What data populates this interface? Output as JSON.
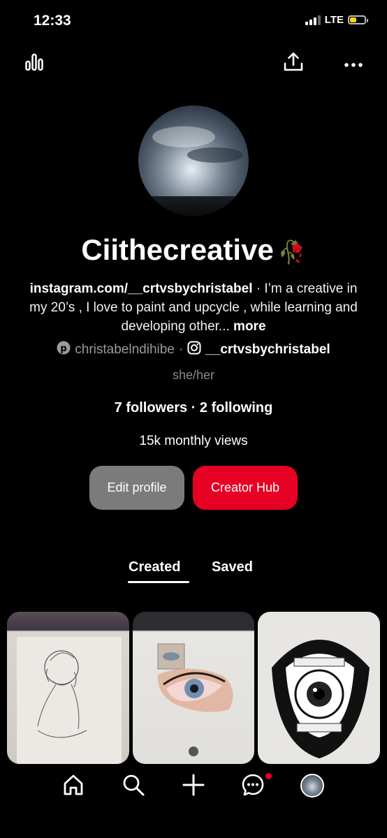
{
  "status_bar": {
    "time": "12:33",
    "network": "LTE"
  },
  "profile": {
    "name": "Ciithecreative",
    "bio_link": "instagram.com/__crtvsbychristabel",
    "bio_text": " · I’m a creative in my 20’s , I love to paint and upcycle , while learning and developing other... ",
    "bio_more": "more",
    "pinterest_handle": "christabelndihibe",
    "separator": "·",
    "instagram_handle": "__crtvsbychristabel",
    "pronouns": "she/her",
    "followers_following": "7 followers · 2 following",
    "monthly_views": "15k monthly views"
  },
  "actions": {
    "edit_profile": "Edit profile",
    "creator_hub": "Creator Hub"
  },
  "tabs": [
    {
      "label": "Created",
      "active": true
    },
    {
      "label": "Saved",
      "active": false
    }
  ],
  "pins": [
    {
      "subject": "pencil sketch of a person holding their face"
    },
    {
      "subject": "realistic painting of an eye on tablet"
    },
    {
      "subject": "ink illustration of an eye inside a mouth"
    }
  ],
  "bottom_nav": [
    {
      "icon": "home-icon"
    },
    {
      "icon": "search-icon"
    },
    {
      "icon": "plus-icon"
    },
    {
      "icon": "messages-icon"
    },
    {
      "icon": "profile-avatar"
    }
  ],
  "colors": {
    "accent": "#e60023",
    "button_gray": "#7b7b7b",
    "background": "#000000"
  }
}
